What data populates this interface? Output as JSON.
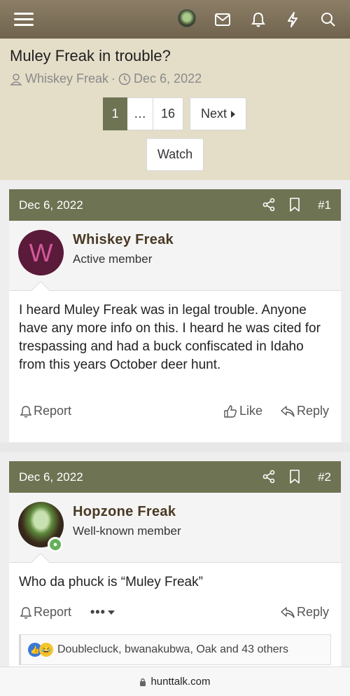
{
  "header": {
    "title": "Muley Freak in trouble?",
    "author": "Whiskey Freak",
    "separator": "·",
    "date": "Dec 6, 2022"
  },
  "pagination": {
    "current": "1",
    "ellipsis": "…",
    "last": "16",
    "next_label": "Next"
  },
  "watch_label": "Watch",
  "posts": [
    {
      "date": "Dec 6, 2022",
      "number": "#1",
      "avatar_letter": "W",
      "username": "Whiskey Freak",
      "user_title": "Active member",
      "body": "I heard Muley Freak was in legal trouble. Anyone have any more info on this. I heard he was cited for trespassing and had a buck confiscated in Idaho from this years October deer hunt.",
      "report_label": "Report",
      "like_label": "Like",
      "reply_label": "Reply"
    },
    {
      "date": "Dec 6, 2022",
      "number": "#2",
      "username": "Hopzone Freak",
      "user_title": "Well-known member",
      "body": "Who da phuck is “Muley Freak”",
      "report_label": "Report",
      "more_label": "•••",
      "reply_label": "Reply",
      "reactions_text": "Doublecluck, bwanakubwa, Oak and 43 others"
    }
  ],
  "browser": {
    "url": "hunttalk.com"
  },
  "colors": {
    "topbar": "#7a6d56",
    "header_bg": "#e4ddc8",
    "accent": "#6e7453",
    "username": "#4a3a24"
  }
}
